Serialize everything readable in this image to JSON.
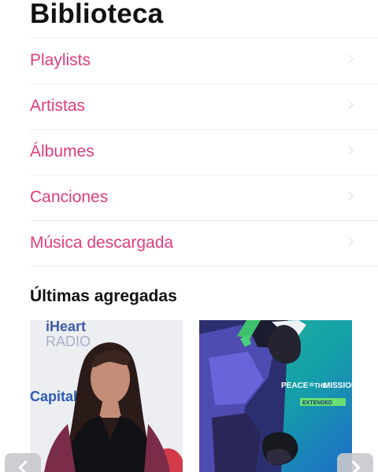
{
  "page": {
    "title": "Biblioteca"
  },
  "library": {
    "items": [
      {
        "label": "Playlists",
        "icon": "chevron-right-icon"
      },
      {
        "label": "Artistas",
        "icon": "chevron-right-icon"
      },
      {
        "label": "Álbumes",
        "icon": "chevron-right-icon"
      },
      {
        "label": "Canciones",
        "icon": "chevron-right-icon"
      },
      {
        "label": "Música descargada",
        "icon": "chevron-right-icon"
      }
    ]
  },
  "recent": {
    "title": "Últimas agregadas",
    "albums": [
      {
        "art_text": "iHeart RADIO Capital",
        "accent": "#2d5bb8"
      },
      {
        "art_text": "PEACE IS THE MISSION EXTENDED",
        "accent": "#1aa3a6"
      }
    ]
  },
  "navigation": {
    "prev_icon": "chevron-left-icon",
    "next_icon": "chevron-right-icon"
  },
  "colors": {
    "accent": "#e03d7e",
    "title": "#111111",
    "divider": "#ececef",
    "chevron": "#dcdce0"
  }
}
